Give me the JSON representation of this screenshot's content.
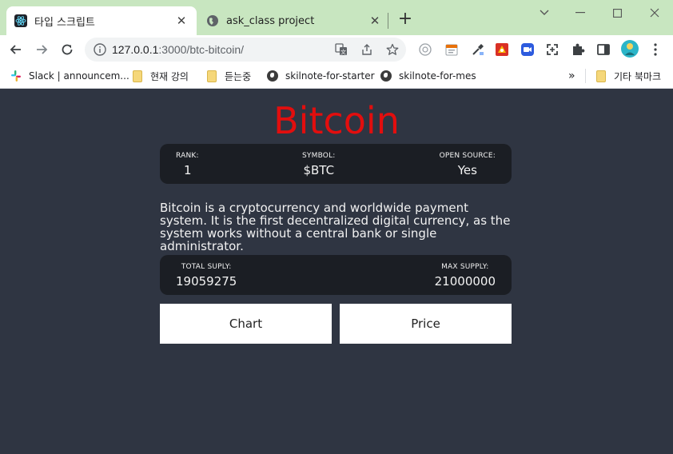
{
  "browser": {
    "tabs": [
      {
        "title": "타입 스크립트",
        "favicon": "react-icon",
        "active": true
      },
      {
        "title": "ask_class project",
        "favicon": "globe-icon",
        "active": false
      }
    ],
    "address": {
      "host": "127.0.0.1",
      "path": ":3000/btc-bitcoin/"
    },
    "bookmarks": [
      {
        "label": "Slack | announcem...",
        "icon": "slack-icon"
      },
      {
        "label": "현재 강의",
        "icon": "folder-icon"
      },
      {
        "label": "듣는중",
        "icon": "folder-icon"
      },
      {
        "label": "skilnote-for-starter",
        "icon": "globe-icon"
      },
      {
        "label": "skilnote-for-mes",
        "icon": "globe-icon"
      }
    ],
    "bookmarks_overflow": "»",
    "other_bookmarks": "기타 북마크"
  },
  "coin": {
    "title": "Bitcoin",
    "overview1": [
      {
        "label": "RANK:",
        "value": "1"
      },
      {
        "label": "SYMBOL:",
        "value": "$BTC"
      },
      {
        "label": "OPEN SOURCE:",
        "value": "Yes"
      }
    ],
    "description": "Bitcoin is a cryptocurrency and worldwide payment system. It is the first decentralized digital currency, as the system works without a central bank or single administrator.",
    "overview2": [
      {
        "label": "TOTAL SUPLY:",
        "value": "19059275"
      },
      {
        "label": "MAX SUPPLY:",
        "value": "21000000"
      }
    ],
    "tabs": [
      {
        "label": "Chart"
      },
      {
        "label": "Price"
      }
    ]
  },
  "colors": {
    "page_background": "#2f3542",
    "title": "#e20e0e",
    "card": "#1b1e24",
    "tab_strip": "#c8e6c0"
  }
}
